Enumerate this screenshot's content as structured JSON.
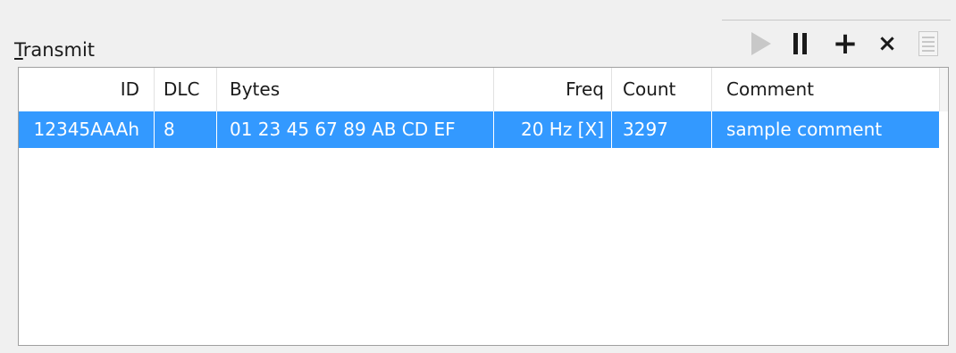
{
  "panel": {
    "title_mnemonic": "T",
    "title_rest": "ransmit"
  },
  "toolbar": {
    "buttons": [
      {
        "name": "play",
        "icon": "play-icon",
        "enabled": false
      },
      {
        "name": "pause",
        "icon": "pause-icon",
        "enabled": true
      },
      {
        "name": "add",
        "icon": "plus-icon",
        "glyph": "+",
        "enabled": true
      },
      {
        "name": "remove",
        "icon": "close-icon",
        "glyph": "×",
        "enabled": true
      },
      {
        "name": "list",
        "icon": "list-icon",
        "enabled": false
      }
    ]
  },
  "table": {
    "columns": [
      "ID",
      "DLC",
      "Bytes",
      "Freq",
      "Count",
      "Comment"
    ],
    "rows": [
      {
        "id": "12345AAAh",
        "dlc": "8",
        "bytes": "01 23 45 67  89 AB CD EF",
        "freq": "20 Hz [X]",
        "count": "3297",
        "comment": "sample comment",
        "selected": true
      }
    ]
  },
  "colors": {
    "selection": "#3399ff",
    "selection_text": "#ffffff",
    "disabled_icon": "#c8c8c8",
    "icon": "#1a1a1a"
  }
}
